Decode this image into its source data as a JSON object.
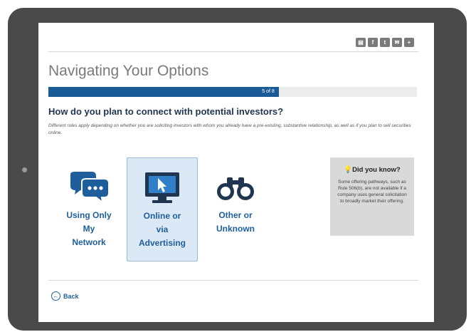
{
  "header": {
    "share_buttons": [
      {
        "icon": "print-icon",
        "glyph": "▤"
      },
      {
        "icon": "facebook-icon",
        "glyph": "f"
      },
      {
        "icon": "twitter-icon",
        "glyph": "t"
      },
      {
        "icon": "email-icon",
        "glyph": "✉"
      },
      {
        "icon": "add-icon",
        "glyph": "+"
      }
    ]
  },
  "page": {
    "title": "Navigating Your Options",
    "progress_label": "5 of 8",
    "progress_fraction": 0.625,
    "question": "How do you plan to connect with potential investors?",
    "description": "Different rules apply depending on whether you are soliciting investors with whom you already have a pre-existing, substantive relationship, as well as if you plan to sell securities online."
  },
  "options": [
    {
      "line1": "Using Only",
      "line2": "My",
      "line3": "Network",
      "icon": "chat-bubbles-icon",
      "selected": false
    },
    {
      "line1": "Online or",
      "line2": "via",
      "line3": "Advertising",
      "icon": "computer-monitor-icon",
      "selected": true
    },
    {
      "line1": "Other or",
      "line2": "Unknown",
      "line3": "",
      "icon": "binoculars-icon",
      "selected": false
    }
  ],
  "did_you_know": {
    "title": "Did you know?",
    "body": "Some offering pathways, such as Rule 506(b), are not available if a company uses general solicitation to broadly market their offering."
  },
  "nav": {
    "back_label": "Back"
  },
  "colors": {
    "accent": "#1a5a96",
    "link": "#1e5e9c",
    "frame": "#4a4a4a"
  }
}
